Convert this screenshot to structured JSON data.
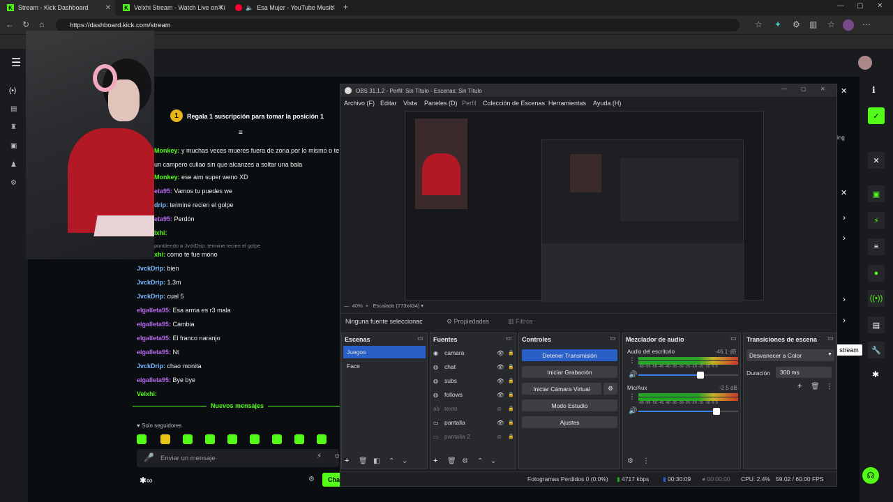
{
  "browser": {
    "tabs": [
      {
        "title": "Stream - Kick Dashboard"
      },
      {
        "title": "Velxhi Stream - Watch Live on Ki"
      },
      {
        "title": "Esa Mujer - YouTube Music"
      }
    ],
    "url": "https://dashboard.kick.com/stream"
  },
  "chat": {
    "goal_badge": "1",
    "goal_text": "Regala 1 suscripción para tomar la posición 1",
    "messages": [
      {
        "user": "Monkey:",
        "text": "y muchas veces mueres fuera de zona por lo mismo o te"
      },
      {
        "user": "",
        "text": "un campero culiao sin que alcanzes a soltar una bala"
      },
      {
        "user": "Monkey:",
        "text": "ese aim super weno XD"
      },
      {
        "user": "eta95:",
        "text": "Vamos tu puedes we"
      },
      {
        "user": "drip:",
        "text": "termine recien el golpe"
      },
      {
        "user": "eta95:",
        "text": "Perdón"
      },
      {
        "user": "lxhi:",
        "text": ""
      },
      {
        "user": "",
        "text": "pondiendo a JvckDrip: termine recien el golpe"
      },
      {
        "user": "xhi:",
        "text": "como te fue mono"
      },
      {
        "user": "JvckDrip:",
        "text": "bien"
      },
      {
        "user": "JvckDrip:",
        "text": "1.3m"
      },
      {
        "user": "JvckDrip:",
        "text": "cual 5"
      },
      {
        "user": "elgalleta95:",
        "text": "Esa arma es r3 mala"
      },
      {
        "user": "elgalleta95:",
        "text": "Cambia"
      },
      {
        "user": "elgalleta95:",
        "text": "El franco naranjo"
      },
      {
        "user": "elgalleta95:",
        "text": "Nt"
      },
      {
        "user": "JvckDrip:",
        "text": "chao monita"
      },
      {
        "user": "elgalleta95:",
        "text": "Bye bye"
      },
      {
        "user": "Velxhi:",
        "text": ""
      }
    ],
    "new_messages": "Nuevos mensajes",
    "followers_only": "Solo seguidores",
    "input_placeholder": "Enviar un mensaje",
    "send_button": "Cha"
  },
  "obs": {
    "title": "OBS 31.1.2 - Perfil: Sin Título - Escenas: Sin Título",
    "menu": [
      "Archivo (F)",
      "Editar",
      "Vista",
      "Paneles (D)",
      "Perfil",
      "Colección de Escenas",
      "Herramientas",
      "Ayuda (H)"
    ],
    "zoom": "40%",
    "scaling": "Escalado (773x434)",
    "no_source": "Ninguna fuente seleccionac",
    "properties": "Propiedades",
    "filters": "Filtros",
    "scenes": {
      "header": "Escenas",
      "items": [
        "Juegos",
        "Face"
      ]
    },
    "sources": {
      "header": "Fuentes",
      "items": [
        "camara",
        "chat",
        "subs",
        "follows",
        "texto",
        "pantalla",
        "pantalla 2"
      ]
    },
    "controls": {
      "header": "Controles",
      "stop_stream": "Detener Transmisión",
      "start_record": "Iniciar Grabación",
      "virtual_cam": "Iniciar Cámara Virtual",
      "studio_mode": "Modo Estudio",
      "settings": "Ajustes"
    },
    "mixer": {
      "header": "Mezclador de audio",
      "channels": [
        {
          "name": "Audio del escritorio",
          "db": "-46.1 dB",
          "level": 0.62
        },
        {
          "name": "Mic/Aux",
          "db": "-2.5 dB",
          "level": 0.78
        }
      ],
      "scale": "-60 -55 -50 -45 -40 -35 -30 -25 -20 -15 -10 -5 0"
    },
    "transitions": {
      "header": "Transiciones de escena",
      "selected": "Desvanecer a Color",
      "duration_label": "Duración",
      "duration": "300 ms"
    },
    "status": {
      "dropped": "Fotogramas Perdidos 0 (0.0%)",
      "bitrate": "4717 kbps",
      "stream_time": "00:30:09",
      "record_time": "00:00:00",
      "cpu": "CPU: 2.4%",
      "fps": "59.02 / 60.00 FPS"
    }
  },
  "kick": {
    "tooltip": "stream",
    "partial_label": "ing"
  },
  "colors": {
    "kick_green": "#53fc18",
    "obs_button_blue": "#2a5fc7"
  }
}
